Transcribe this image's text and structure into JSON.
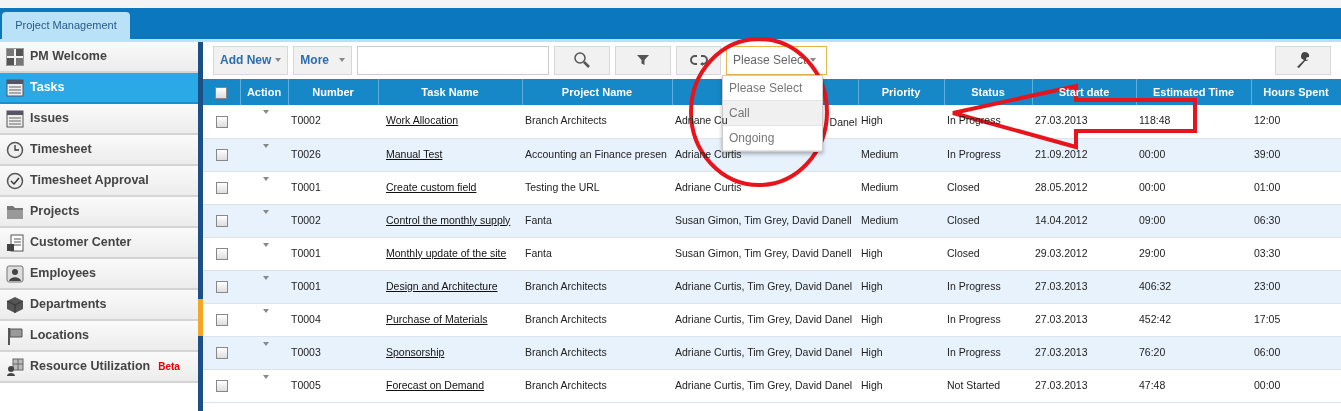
{
  "tabs": [
    {
      "label": "Project Management",
      "selected": true
    }
  ],
  "sidebar": {
    "items": [
      {
        "label": "PM Welcome",
        "selected": false
      },
      {
        "label": "Tasks",
        "selected": true
      },
      {
        "label": "Issues",
        "selected": false
      },
      {
        "label": "Timesheet",
        "selected": false
      },
      {
        "label": "Timesheet Approval",
        "selected": false
      },
      {
        "label": "Projects",
        "selected": false
      },
      {
        "label": "Customer Center",
        "selected": false
      },
      {
        "label": "Employees",
        "selected": false
      },
      {
        "label": "Departments",
        "selected": false
      },
      {
        "label": "Locations",
        "selected": false
      },
      {
        "label": "Resource Utilization",
        "selected": false,
        "badge": "Beta"
      }
    ]
  },
  "toolbar": {
    "add_new": "Add New",
    "more": "More",
    "filter_select": {
      "value": "Please Select",
      "options": [
        {
          "label": "Please Select",
          "highlighted": false
        },
        {
          "label": "Call",
          "highlighted": true
        },
        {
          "label": "Ongoing",
          "highlighted": false
        }
      ]
    }
  },
  "table": {
    "select_all_checked": false,
    "columns": [
      "Action",
      "Number",
      "Task Name",
      "Project Name",
      "",
      "Priority",
      "Status",
      "Start date",
      "Estimated Time",
      "Hours Spent"
    ],
    "rows": [
      {
        "checked": false,
        "number": "T0002",
        "task": "Work Allocation",
        "project": "Branch Architects",
        "members": "Adriane Cu",
        "members_tail": "Danel",
        "priority": "High",
        "status": "In Progress",
        "start": "27.03.2013",
        "estimated": "118:48",
        "hours": "12:00"
      },
      {
        "checked": false,
        "number": "T0026",
        "task": "Manual Test",
        "project": "Accounting an Finance presen",
        "members": "Adriane Curtis",
        "priority": "Medium",
        "status": "In Progress",
        "start": "21.09.2012",
        "estimated": "00:00",
        "hours": "39:00"
      },
      {
        "checked": false,
        "number": "T0001",
        "task": "Create custom field",
        "project": "Testing the URL",
        "members": "Adriane Curtis",
        "priority": "Medium",
        "status": "Closed",
        "start": "28.05.2012",
        "estimated": "00:00",
        "hours": "01:00"
      },
      {
        "checked": false,
        "number": "T0002",
        "task": "Control the monthly supply",
        "project": "Fanta",
        "members": "Susan Gimon, Tim Grey, David Danell",
        "priority": "Medium",
        "status": "Closed",
        "start": "14.04.2012",
        "estimated": "09:00",
        "hours": "06:30"
      },
      {
        "checked": false,
        "number": "T0001",
        "task": "Monthly update of the site",
        "project": "Fanta",
        "members": "Susan Gimon, Tim Grey, David Danell",
        "priority": "High",
        "status": "Closed",
        "start": "29.03.2012",
        "estimated": "29:00",
        "hours": "03:30"
      },
      {
        "checked": false,
        "number": "T0001",
        "task": "Design and Architecture",
        "project": "Branch Architects",
        "members": "Adriane Curtis, Tim Grey, David Danel",
        "priority": "High",
        "status": "In Progress",
        "start": "27.03.2013",
        "estimated": "406:32",
        "hours": "23:00"
      },
      {
        "checked": false,
        "number": "T0004",
        "task": "Purchase of Materials",
        "project": "Branch Architects",
        "members": "Adriane Curtis, Tim Grey, David Danel",
        "priority": "High",
        "status": "In Progress",
        "start": "27.03.2013",
        "estimated": "452:42",
        "hours": "17:05"
      },
      {
        "checked": false,
        "number": "T0003",
        "task": "Sponsorship",
        "project": "Branch Architects",
        "members": "Adriane Curtis, Tim Grey, David Danel",
        "priority": "High",
        "status": "In Progress",
        "start": "27.03.2013",
        "estimated": "76:20",
        "hours": "06:00"
      },
      {
        "checked": false,
        "number": "T0005",
        "task": "Forecast on Demand",
        "project": "Branch Architects",
        "members": "Adriane Curtis, Tim Grey, David Danel",
        "priority": "High",
        "status": "Not Started",
        "start": "27.03.2013",
        "estimated": "47:48",
        "hours": "00:00"
      }
    ]
  }
}
